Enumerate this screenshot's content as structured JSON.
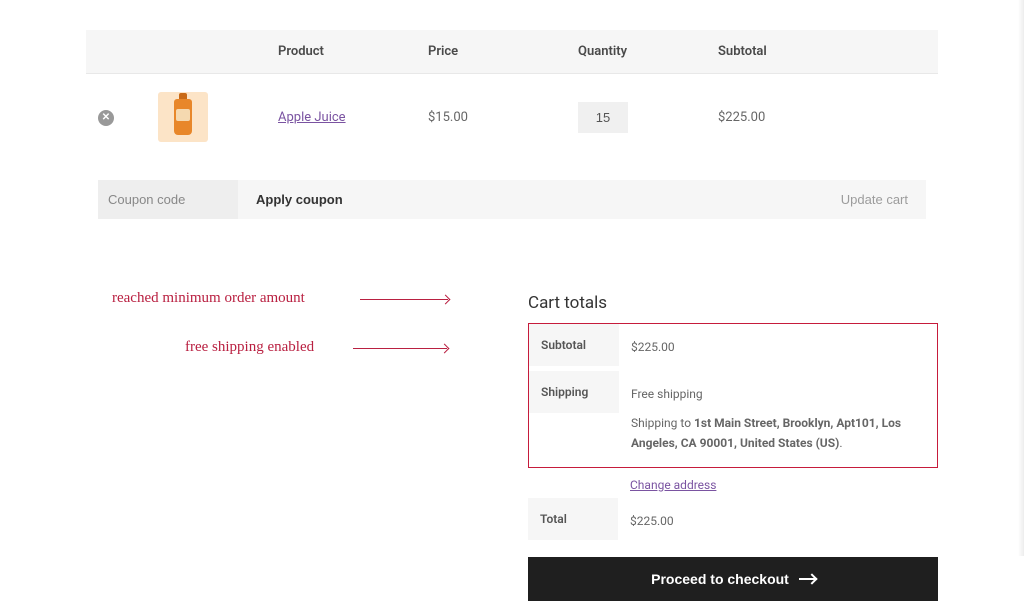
{
  "cart": {
    "columns": {
      "product": "Product",
      "price": "Price",
      "quantity": "Quantity",
      "subtotal": "Subtotal"
    },
    "items": [
      {
        "name": "Apple Juice",
        "price": "$15.00",
        "qty": "15",
        "subtotal": "$225.00",
        "icon": "bottle-icon"
      }
    ],
    "coupon_placeholder": "Coupon code",
    "apply_label": "Apply coupon",
    "update_label": "Update cart"
  },
  "totals": {
    "heading": "Cart totals",
    "subtotal_label": "Subtotal",
    "subtotal_value": "$225.00",
    "shipping_label": "Shipping",
    "shipping_value": "Free shipping",
    "shipping_to_prefix": "Shipping to ",
    "shipping_address": "1st Main Street, Brooklyn, Apt101, Los Angeles, CA 90001, United States (US)",
    "shipping_to_suffix": ".",
    "change_address": "Change address",
    "total_label": "Total",
    "total_value": "$225.00",
    "checkout_label": "Proceed to checkout"
  },
  "annotations": {
    "min_order": "reached minimum order amount",
    "free_ship": "free shipping enabled"
  }
}
